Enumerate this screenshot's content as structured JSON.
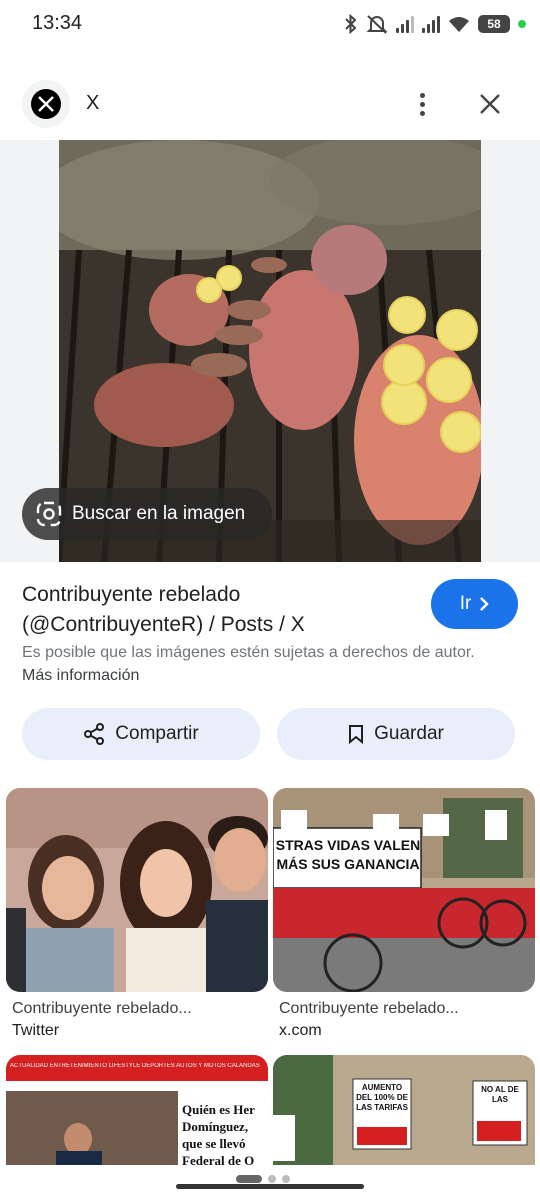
{
  "status_bar": {
    "time": "13:34",
    "battery": "58"
  },
  "header": {
    "site_name": "X",
    "logo_icon": "x-logo-icon"
  },
  "hero": {
    "lens_label": "Buscar en la imagen"
  },
  "result": {
    "title": "Contribuyente rebelado (@ContribuyenteR) / Posts / X",
    "go_label": "Ir",
    "notice": "Es posible que las imágenes estén sujetas a derechos de autor.",
    "more_info": "Más información"
  },
  "actions": {
    "share_label": "Compartir",
    "save_label": "Guardar"
  },
  "related": [
    {
      "title": "Contribuyente rebelado...",
      "source": "Twitter"
    },
    {
      "title": "Contribuyente rebelado...",
      "source": "x.com"
    }
  ],
  "related_thumbs": {
    "protest_banner": "STRAS VIDAS VALEN MÁS SUS GANANCIA",
    "sign_1": "AUMENTO DEL 100% DE LAS TARIFAS",
    "sign_2": "NO AL DE LAS",
    "news_headline": "Quién es Her Domínguez, que se llevó Federal de O",
    "news_nav": "ACTUALIDAD ENTRETENIMIENTO LIFESTYLE DEPORTES AUTOS Y MOTOS CALANDAS"
  },
  "colors": {
    "accent": "#1a73e8",
    "chip_bg": "#e8eefa",
    "surface": "#f1f3f4"
  }
}
